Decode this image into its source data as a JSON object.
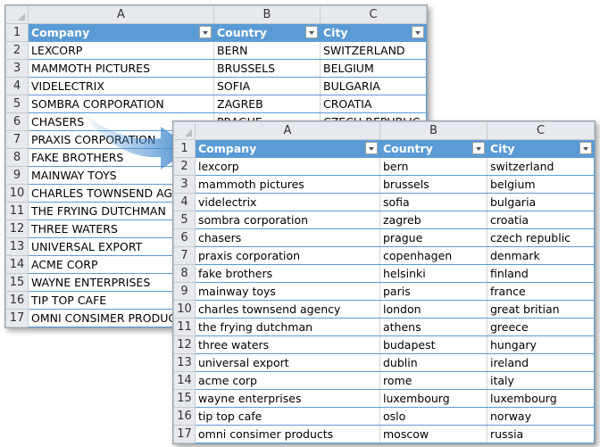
{
  "colors": {
    "header": "#5b9bd5",
    "arrow": "#4a8fd0"
  },
  "columns": [
    "A",
    "B",
    "C"
  ],
  "back": {
    "headers": [
      "Company",
      "Country",
      "City"
    ],
    "rows": [
      [
        "LEXCORP",
        "BERN",
        "SWITZERLAND"
      ],
      [
        "MAMMOTH PICTURES",
        "BRUSSELS",
        "BELGIUM"
      ],
      [
        "VIDELECTRIX",
        "SOFIA",
        "BULGARIA"
      ],
      [
        "SOMBRA CORPORATION",
        "ZAGREB",
        "CROATIA"
      ],
      [
        "CHASERS",
        "PRAGUE",
        "CZECH REPUBLIC"
      ],
      [
        "PRAXIS CORPORATION",
        "",
        ""
      ],
      [
        "FAKE BROTHERS",
        "",
        ""
      ],
      [
        "MAINWAY TOYS",
        "",
        ""
      ],
      [
        "CHARLES TOWNSEND AGENCY",
        "",
        ""
      ],
      [
        "THE FRYING DUTCHMAN",
        "",
        ""
      ],
      [
        "THREE WATERS",
        "",
        ""
      ],
      [
        "UNIVERSAL EXPORT",
        "",
        ""
      ],
      [
        "ACME CORP",
        "",
        ""
      ],
      [
        "WAYNE ENTERPRISES",
        "",
        ""
      ],
      [
        "TIP TOP CAFE",
        "",
        ""
      ],
      [
        "OMNI CONSIMER PRODUCTS",
        "",
        ""
      ]
    ]
  },
  "front": {
    "headers": [
      "Company",
      "Country",
      "City"
    ],
    "rows": [
      [
        "lexcorp",
        "bern",
        "switzerland"
      ],
      [
        "mammoth pictures",
        "brussels",
        "belgium"
      ],
      [
        "videlectrix",
        "sofia",
        "bulgaria"
      ],
      [
        "sombra corporation",
        "zagreb",
        "croatia"
      ],
      [
        "chasers",
        "prague",
        "czech republic"
      ],
      [
        "praxis corporation",
        "copenhagen",
        "denmark"
      ],
      [
        "fake brothers",
        "helsinki",
        "finland"
      ],
      [
        "mainway toys",
        "paris",
        "france"
      ],
      [
        "charles townsend agency",
        "london",
        "great britian"
      ],
      [
        "the frying dutchman",
        "athens",
        "greece"
      ],
      [
        "three waters",
        "budapest",
        "hungary"
      ],
      [
        "universal export",
        "dublin",
        "ireland"
      ],
      [
        "acme corp",
        "rome",
        "italy"
      ],
      [
        "wayne enterprises",
        "luxembourg",
        "luxembourg"
      ],
      [
        "tip top cafe",
        "oslo",
        "norway"
      ],
      [
        "omni consimer products",
        "moscow",
        "russia"
      ]
    ]
  }
}
